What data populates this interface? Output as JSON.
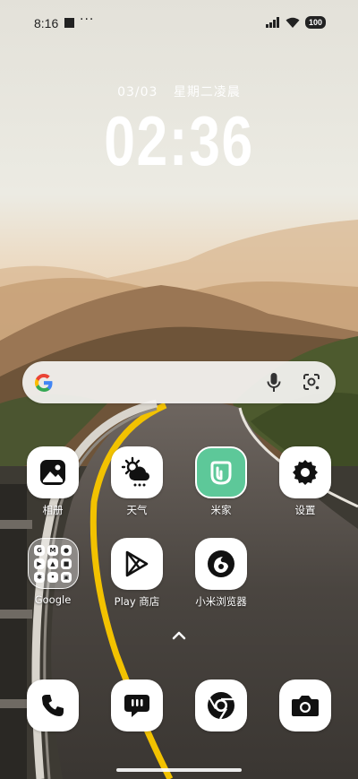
{
  "status_bar": {
    "time": "8:16",
    "dots": "···",
    "battery": "100"
  },
  "lock": {
    "date": "03/03",
    "weekday": "星期二凌晨",
    "clock": "02:36"
  },
  "search": {
    "logo": "google-g-icon",
    "icons": [
      "mic-icon",
      "lens-icon"
    ]
  },
  "apps": {
    "gallery": "相册",
    "weather": "天气",
    "mihome": "米家",
    "settings": "设置",
    "google": "Google",
    "play": "Play 商店",
    "browser": "小米浏览器"
  },
  "dock": [
    "phone-icon",
    "messages-icon",
    "chrome-icon",
    "camera-icon"
  ],
  "colors": {
    "mihome": "#5dc899",
    "accent_yellow": "#f2c200"
  }
}
